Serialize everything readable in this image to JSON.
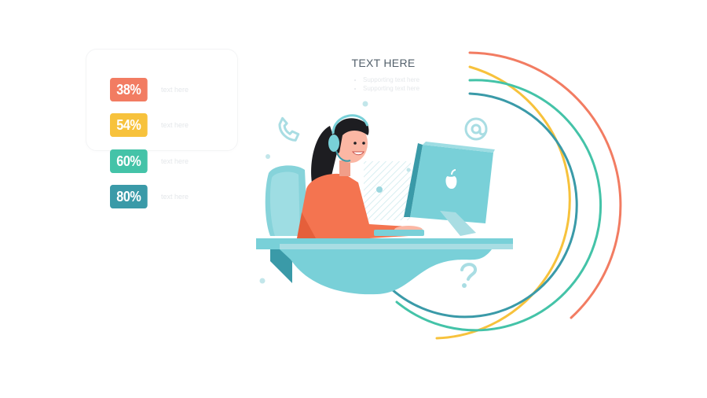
{
  "stats": [
    {
      "label": "38%",
      "text": "text here",
      "color": "#f27c62"
    },
    {
      "label": "54%",
      "text": "text here",
      "color": "#f7c23c"
    },
    {
      "label": "60%",
      "text": "text here",
      "color": "#44c3a8"
    },
    {
      "label": "80%",
      "text": "text here",
      "color": "#3a9aa8"
    }
  ],
  "main": {
    "title": "TEXT HERE",
    "bullets": [
      "Supporting text here",
      "Supporting text here"
    ]
  },
  "palette": {
    "arc_outer": "#f27c62",
    "arc_second": "#f7c23c",
    "arc_third": "#44c3a8",
    "arc_inner": "#3a9aa8",
    "shirt": "#f47450",
    "teal": "#79d0d8",
    "teal_dark": "#3a9aa8",
    "hair": "#1d1d21",
    "skin": "#fbb7a4"
  },
  "icons": [
    "phone-icon",
    "at-sign-icon",
    "question-mark-icon",
    "apple-logo-icon"
  ]
}
